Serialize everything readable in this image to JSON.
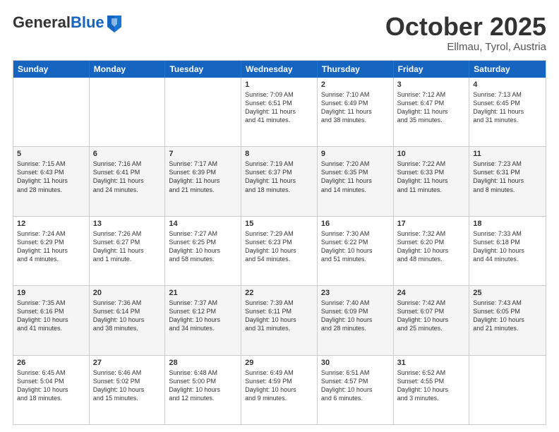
{
  "header": {
    "logo_general": "General",
    "logo_blue": "Blue",
    "month_title": "October 2025",
    "subtitle": "Ellmau, Tyrol, Austria"
  },
  "weekdays": [
    "Sunday",
    "Monday",
    "Tuesday",
    "Wednesday",
    "Thursday",
    "Friday",
    "Saturday"
  ],
  "rows": [
    [
      {
        "day": "",
        "info": ""
      },
      {
        "day": "",
        "info": ""
      },
      {
        "day": "",
        "info": ""
      },
      {
        "day": "1",
        "info": "Sunrise: 7:09 AM\nSunset: 6:51 PM\nDaylight: 11 hours\nand 41 minutes."
      },
      {
        "day": "2",
        "info": "Sunrise: 7:10 AM\nSunset: 6:49 PM\nDaylight: 11 hours\nand 38 minutes."
      },
      {
        "day": "3",
        "info": "Sunrise: 7:12 AM\nSunset: 6:47 PM\nDaylight: 11 hours\nand 35 minutes."
      },
      {
        "day": "4",
        "info": "Sunrise: 7:13 AM\nSunset: 6:45 PM\nDaylight: 11 hours\nand 31 minutes."
      }
    ],
    [
      {
        "day": "5",
        "info": "Sunrise: 7:15 AM\nSunset: 6:43 PM\nDaylight: 11 hours\nand 28 minutes."
      },
      {
        "day": "6",
        "info": "Sunrise: 7:16 AM\nSunset: 6:41 PM\nDaylight: 11 hours\nand 24 minutes."
      },
      {
        "day": "7",
        "info": "Sunrise: 7:17 AM\nSunset: 6:39 PM\nDaylight: 11 hours\nand 21 minutes."
      },
      {
        "day": "8",
        "info": "Sunrise: 7:19 AM\nSunset: 6:37 PM\nDaylight: 11 hours\nand 18 minutes."
      },
      {
        "day": "9",
        "info": "Sunrise: 7:20 AM\nSunset: 6:35 PM\nDaylight: 11 hours\nand 14 minutes."
      },
      {
        "day": "10",
        "info": "Sunrise: 7:22 AM\nSunset: 6:33 PM\nDaylight: 11 hours\nand 11 minutes."
      },
      {
        "day": "11",
        "info": "Sunrise: 7:23 AM\nSunset: 6:31 PM\nDaylight: 11 hours\nand 8 minutes."
      }
    ],
    [
      {
        "day": "12",
        "info": "Sunrise: 7:24 AM\nSunset: 6:29 PM\nDaylight: 11 hours\nand 4 minutes."
      },
      {
        "day": "13",
        "info": "Sunrise: 7:26 AM\nSunset: 6:27 PM\nDaylight: 11 hours\nand 1 minute."
      },
      {
        "day": "14",
        "info": "Sunrise: 7:27 AM\nSunset: 6:25 PM\nDaylight: 10 hours\nand 58 minutes."
      },
      {
        "day": "15",
        "info": "Sunrise: 7:29 AM\nSunset: 6:23 PM\nDaylight: 10 hours\nand 54 minutes."
      },
      {
        "day": "16",
        "info": "Sunrise: 7:30 AM\nSunset: 6:22 PM\nDaylight: 10 hours\nand 51 minutes."
      },
      {
        "day": "17",
        "info": "Sunrise: 7:32 AM\nSunset: 6:20 PM\nDaylight: 10 hours\nand 48 minutes."
      },
      {
        "day": "18",
        "info": "Sunrise: 7:33 AM\nSunset: 6:18 PM\nDaylight: 10 hours\nand 44 minutes."
      }
    ],
    [
      {
        "day": "19",
        "info": "Sunrise: 7:35 AM\nSunset: 6:16 PM\nDaylight: 10 hours\nand 41 minutes."
      },
      {
        "day": "20",
        "info": "Sunrise: 7:36 AM\nSunset: 6:14 PM\nDaylight: 10 hours\nand 38 minutes."
      },
      {
        "day": "21",
        "info": "Sunrise: 7:37 AM\nSunset: 6:12 PM\nDaylight: 10 hours\nand 34 minutes."
      },
      {
        "day": "22",
        "info": "Sunrise: 7:39 AM\nSunset: 6:11 PM\nDaylight: 10 hours\nand 31 minutes."
      },
      {
        "day": "23",
        "info": "Sunrise: 7:40 AM\nSunset: 6:09 PM\nDaylight: 10 hours\nand 28 minutes."
      },
      {
        "day": "24",
        "info": "Sunrise: 7:42 AM\nSunset: 6:07 PM\nDaylight: 10 hours\nand 25 minutes."
      },
      {
        "day": "25",
        "info": "Sunrise: 7:43 AM\nSunset: 6:05 PM\nDaylight: 10 hours\nand 21 minutes."
      }
    ],
    [
      {
        "day": "26",
        "info": "Sunrise: 6:45 AM\nSunset: 5:04 PM\nDaylight: 10 hours\nand 18 minutes."
      },
      {
        "day": "27",
        "info": "Sunrise: 6:46 AM\nSunset: 5:02 PM\nDaylight: 10 hours\nand 15 minutes."
      },
      {
        "day": "28",
        "info": "Sunrise: 6:48 AM\nSunset: 5:00 PM\nDaylight: 10 hours\nand 12 minutes."
      },
      {
        "day": "29",
        "info": "Sunrise: 6:49 AM\nSunset: 4:59 PM\nDaylight: 10 hours\nand 9 minutes."
      },
      {
        "day": "30",
        "info": "Sunrise: 6:51 AM\nSunset: 4:57 PM\nDaylight: 10 hours\nand 6 minutes."
      },
      {
        "day": "31",
        "info": "Sunrise: 6:52 AM\nSunset: 4:55 PM\nDaylight: 10 hours\nand 3 minutes."
      },
      {
        "day": "",
        "info": ""
      }
    ]
  ]
}
